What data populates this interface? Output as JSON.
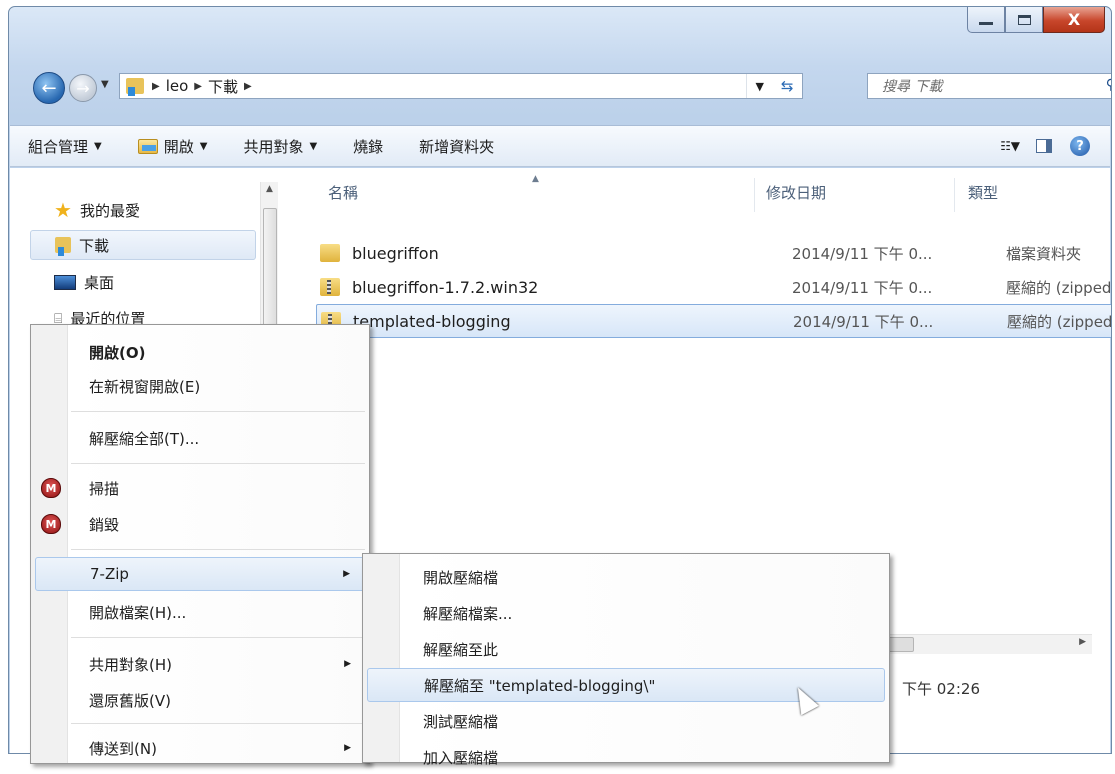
{
  "window": {
    "caption_buttons": {
      "minimize": "–",
      "maximize": "□",
      "close": "X"
    }
  },
  "navbar": {
    "breadcrumbs": [
      "leo",
      "下載"
    ],
    "search_placeholder": "搜尋 下載"
  },
  "commandbar": {
    "organize": "組合管理",
    "open": "開啟",
    "share": "共用對象",
    "burn": "燒錄",
    "new_folder": "新增資料夾"
  },
  "navpane": {
    "favorites": "我的最愛",
    "items": [
      "下載",
      "桌面",
      "最近的位置"
    ]
  },
  "filepane": {
    "columns": {
      "name": "名稱",
      "date": "修改日期",
      "type": "類型"
    },
    "rows": [
      {
        "name": "bluegriffon",
        "date": "2014/9/11 下午 0...",
        "type": "檔案資料夾",
        "icon": "folder-icon"
      },
      {
        "name": "bluegriffon-1.7.2.win32",
        "date": "2014/9/11 下午 0...",
        "type": "壓縮的 (zipped)",
        "icon": "zip-icon"
      },
      {
        "name": "templated-blogging",
        "date": "2014/9/11 下午 0...",
        "type": "壓縮的 (zipped)",
        "icon": "zip-icon",
        "selected": true
      }
    ],
    "details_time": "下午 02:26"
  },
  "context_menu": {
    "open": "開啟(O)",
    "open_new_window": "在新視窗開啟(E)",
    "extract_all": "解壓縮全部(T)...",
    "scan": "掃描",
    "shred": "銷毀",
    "seven_zip": "7-Zip",
    "open_with": "開啟檔案(H)...",
    "share_with": "共用對象(H)",
    "restore": "還原舊版(V)",
    "send_to": "傳送到(N)"
  },
  "submenu": {
    "open_archive": "開啟壓縮檔",
    "extract_files": "解壓縮檔案...",
    "extract_here": "解壓縮至此",
    "extract_to": "解壓縮至 \"templated-blogging\\\"",
    "test_archive": "測試壓縮檔",
    "add_to_archive": "加入壓縮檔"
  },
  "colors": {
    "accent": "#2767b0",
    "selection": "#d7e6f8",
    "close": "#c8462b"
  }
}
